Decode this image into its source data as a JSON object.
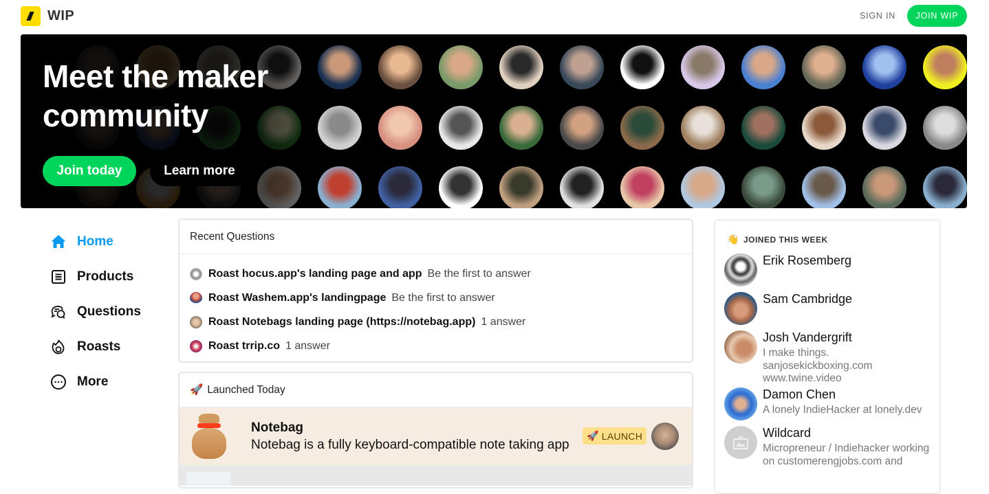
{
  "header": {
    "brand": "WIP",
    "sign_in": "SIGN IN",
    "join": "JOIN WIP",
    "accent_color": "#00d55b",
    "logo_color": "#ffdd00"
  },
  "hero": {
    "title_line1": "Meet the maker",
    "title_line2": "community",
    "join_button": "Join today",
    "learn_button": "Learn more",
    "avatar_count": 45
  },
  "nav": {
    "items": [
      {
        "label": "Home",
        "icon": "home-icon",
        "active": true
      },
      {
        "label": "Products",
        "icon": "products-icon",
        "active": false
      },
      {
        "label": "Questions",
        "icon": "questions-icon",
        "active": false
      },
      {
        "label": "Roasts",
        "icon": "roasts-icon",
        "active": false
      },
      {
        "label": "More",
        "icon": "more-icon",
        "active": false
      }
    ],
    "active_color": "#0a9bf0"
  },
  "questions": {
    "title": "Recent Questions",
    "items": [
      {
        "title": "Roast hocus.app's landing page and app",
        "meta": "Be the first to answer"
      },
      {
        "title": "Roast Washem.app's landingpage",
        "meta": "Be the first to answer"
      },
      {
        "title": "Roast Notebags landing page (https://notebag.app)",
        "meta": "1 answer"
      },
      {
        "title": "Roast trrip.co",
        "meta": "1 answer"
      }
    ]
  },
  "launched": {
    "title_icon": "🚀",
    "title": "Launched Today",
    "product": {
      "name": "Notebag",
      "description": "Notebag is a fully keyboard-compatible note taking app",
      "badge_icon": "🚀",
      "badge": "LAUNCH"
    }
  },
  "joined": {
    "icon": "👋",
    "title": "JOINED THIS WEEK",
    "members": [
      {
        "name": "Erik Rosemberg",
        "bio": ""
      },
      {
        "name": "Sam Cambridge",
        "bio": ""
      },
      {
        "name": "Josh Vandergrift",
        "bio": "I make things. sanjosekickboxing.com www.twine.video"
      },
      {
        "name": "Damon Chen",
        "bio": "A lonely IndieHacker at lonely.dev"
      },
      {
        "name": "Wildcard",
        "bio": "Micropreneur / Indiehacker working on customerengjobs.com and"
      }
    ]
  }
}
